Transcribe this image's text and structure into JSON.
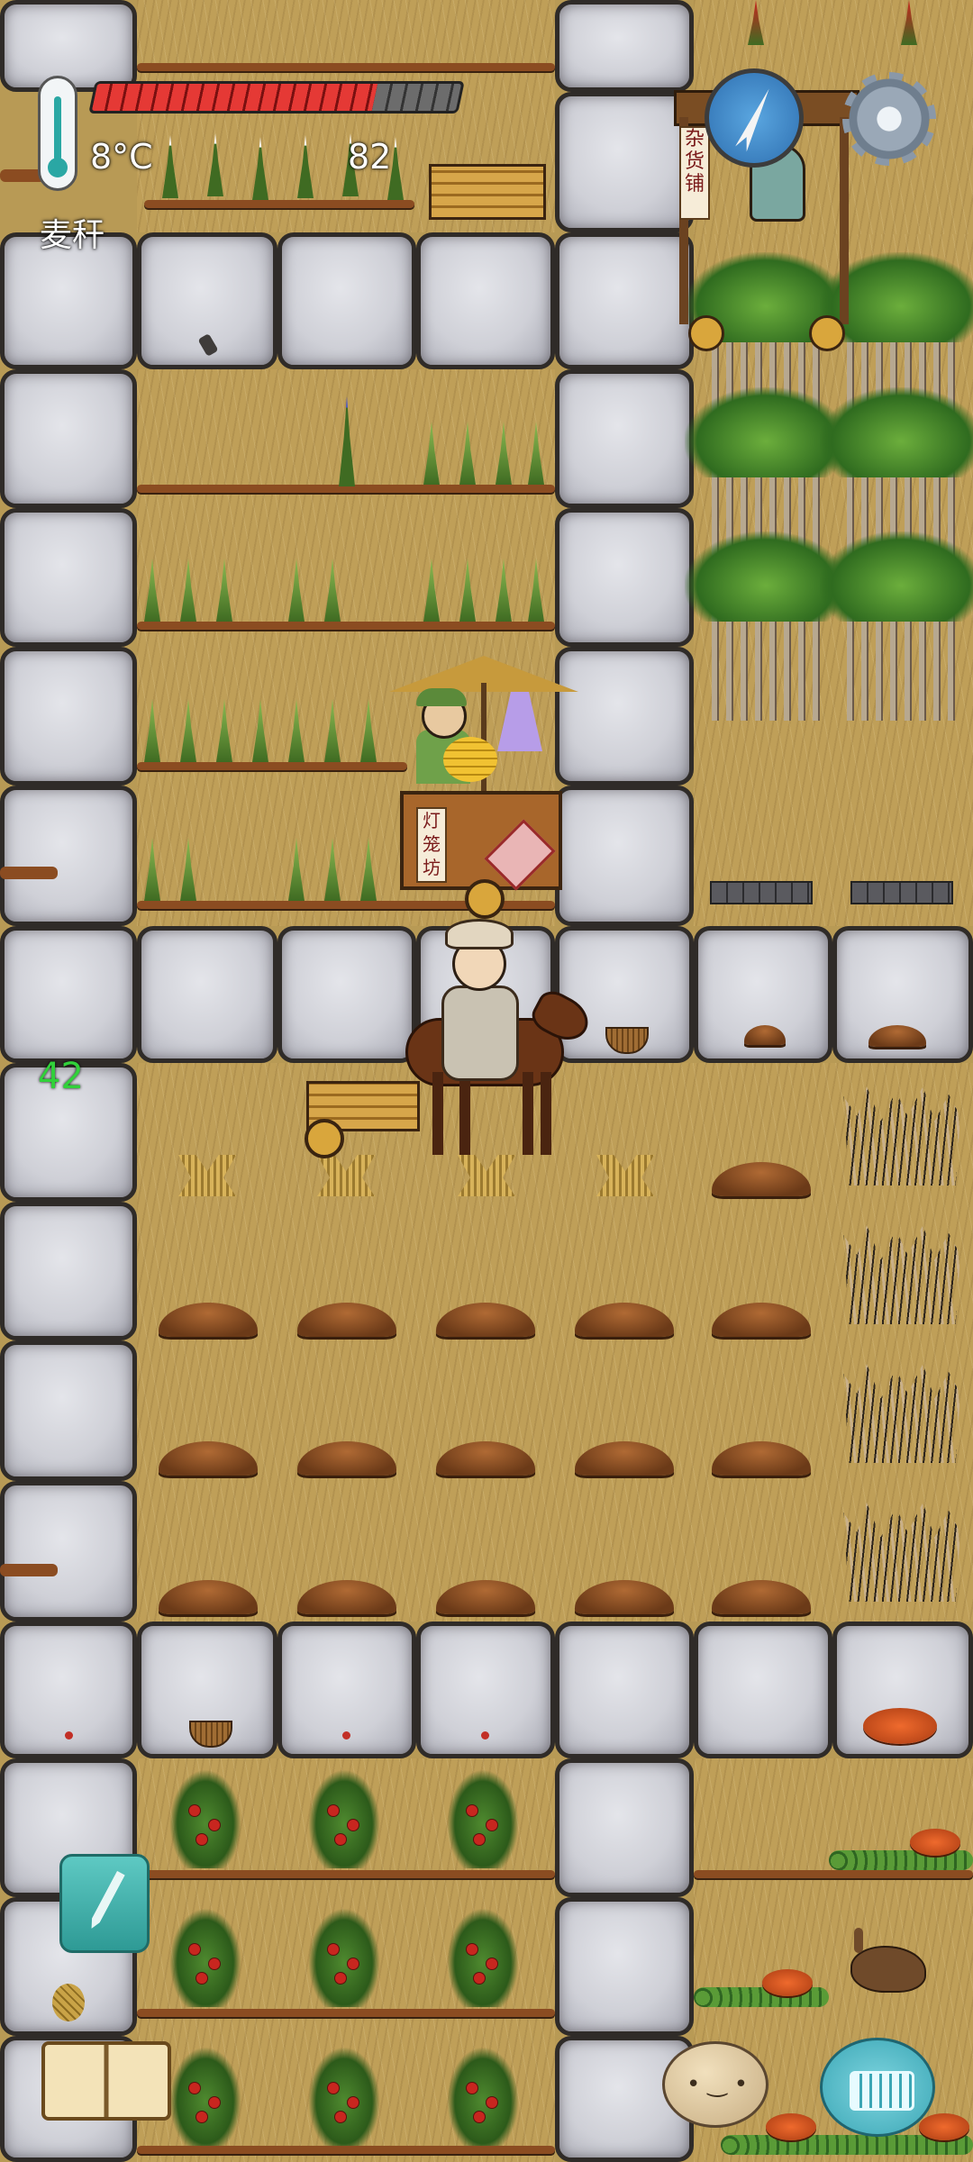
{
  "hud": {
    "temperature": "8°C",
    "hp_value": "82",
    "health_fraction": 0.77,
    "held_item": "麦秆",
    "counter": "42",
    "icons": {
      "thermometer": "thermometer-icon",
      "compass": "compass-icon",
      "settings": "gear-icon",
      "journal": "pen-icon",
      "book": "book-icon",
      "emote": "face-icon",
      "keyboard": "keyboard-icon"
    }
  },
  "signs": {
    "grocery_stall": "杂货铺",
    "lantern_cart": "灯笼坊"
  },
  "colors": {
    "ground": "#bf9f58",
    "stone": "#cfd0d7",
    "health": "#e53935",
    "counter": "#31d13a",
    "accent_teal": "#2e9a95"
  }
}
